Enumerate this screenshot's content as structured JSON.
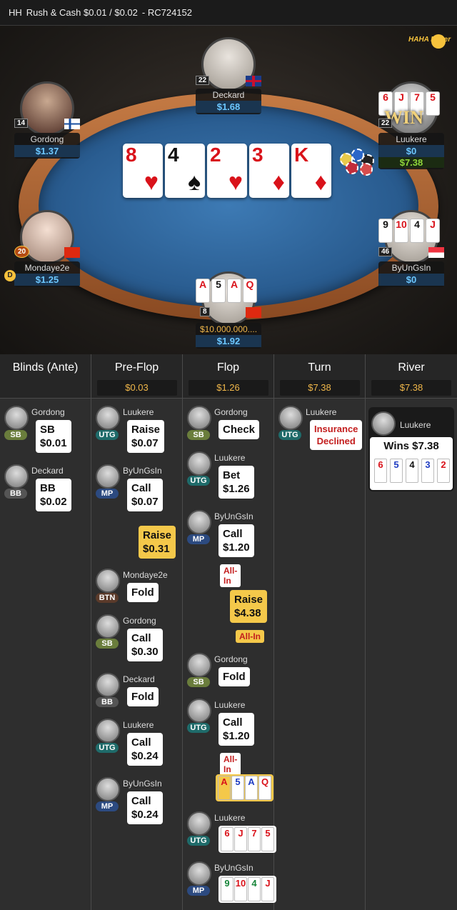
{
  "header": {
    "mode": "HH",
    "title": "Rush & Cash $0.01 / $0.02",
    "id": "- RC724152"
  },
  "logo": "HAHA Poker",
  "board": [
    {
      "rank": "8",
      "suit": "♥",
      "color": "red"
    },
    {
      "rank": "4",
      "suit": "♠",
      "color": "blk"
    },
    {
      "rank": "2",
      "suit": "♥",
      "color": "red"
    },
    {
      "rank": "3",
      "suit": "♦",
      "color": "red"
    },
    {
      "rank": "K",
      "suit": "♦",
      "color": "red"
    }
  ],
  "seats": {
    "deckard": {
      "name": "Deckard",
      "stack": "$1.68",
      "level": "22"
    },
    "gordong": {
      "name": "Gordong",
      "stack": "$1.37",
      "level": "14"
    },
    "luukere": {
      "name": "Luukere",
      "stack": "$0",
      "level": "22",
      "won": "$7.38",
      "badge": "WIN",
      "cards": [
        "6",
        "J",
        "7",
        "5"
      ]
    },
    "mondaye": {
      "name": "Mondaye2e",
      "stack": "$1.25",
      "level": "20",
      "dealer": "D"
    },
    "byungsin": {
      "name": "ByUnGsIn",
      "stack": "$0",
      "level": "46",
      "cards": [
        "9",
        "10",
        "4",
        "J"
      ]
    },
    "hero": {
      "name": "$10.000.000....",
      "stack": "$1.92",
      "level": "8",
      "cards": [
        "A",
        "5",
        "A",
        "Q"
      ]
    }
  },
  "streets": [
    {
      "label": "Blinds (Ante)",
      "pot": ""
    },
    {
      "label": "Pre-Flop",
      "pot": "$0.03"
    },
    {
      "label": "Flop",
      "pot": "$1.26"
    },
    {
      "label": "Turn",
      "pot": "$7.38"
    },
    {
      "label": "River",
      "pot": "$7.38"
    }
  ],
  "blinds": [
    {
      "name": "Gordong",
      "pos": "SB",
      "action": "SB",
      "amount": "$0.01"
    },
    {
      "name": "Deckard",
      "pos": "BB",
      "action": "BB",
      "amount": "$0.02"
    }
  ],
  "preflop": [
    {
      "name": "Luukere",
      "pos": "UTG",
      "action": "Raise",
      "amount": "$0.07"
    },
    {
      "name": "ByUnGsIn",
      "pos": "MP",
      "action": "Call",
      "amount": "$0.07"
    },
    {
      "action": "Raise",
      "amount": "$0.31"
    },
    {
      "name": "Mondaye2e",
      "pos": "BTN",
      "action": "Fold"
    },
    {
      "name": "Gordong",
      "pos": "SB",
      "action": "Call",
      "amount": "$0.30"
    },
    {
      "name": "Deckard",
      "pos": "BB",
      "action": "Fold"
    },
    {
      "name": "Luukere",
      "pos": "UTG",
      "action": "Call",
      "amount": "$0.24"
    },
    {
      "name": "ByUnGsIn",
      "pos": "MP",
      "action": "Call",
      "amount": "$0.24"
    }
  ],
  "flop": [
    {
      "name": "Gordong",
      "pos": "SB",
      "action": "Check"
    },
    {
      "name": "Luukere",
      "pos": "UTG",
      "action": "Bet",
      "amount": "$1.26"
    },
    {
      "name": "ByUnGsIn",
      "pos": "MP",
      "action": "Call",
      "amount": "$1.20",
      "tag": "All-In"
    },
    {
      "action": "Raise",
      "amount": "$4.38",
      "tag": "All-In"
    },
    {
      "name": "Gordong",
      "pos": "SB",
      "action": "Fold"
    },
    {
      "name": "Luukere",
      "pos": "UTG",
      "action": "Call",
      "amount": "$1.20",
      "tag": "All-In"
    }
  ],
  "showdown": {
    "hero_cards": [
      "A",
      "5",
      "A",
      "Q"
    ],
    "luukere": {
      "name": "Luukere",
      "pos": "UTG",
      "cards": [
        "6",
        "J",
        "7",
        "5"
      ]
    },
    "byungsin": {
      "name": "ByUnGsIn",
      "pos": "MP",
      "cards": [
        "9",
        "10",
        "4",
        "J"
      ]
    }
  },
  "turn": {
    "name": "Luukere",
    "pos": "UTG",
    "note1": "Insurance",
    "note2": "Declined"
  },
  "river": {
    "name": "Luukere",
    "result": "Wins $7.38",
    "cards": [
      "6",
      "5",
      "4",
      "3",
      "2"
    ]
  }
}
